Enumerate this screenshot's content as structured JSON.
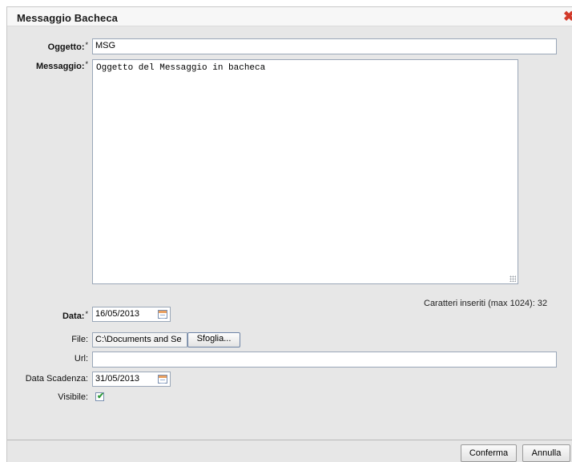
{
  "dialog": {
    "title": "Messaggio Bacheca",
    "close_icon": "close-icon",
    "close_color": "#d23a2a"
  },
  "form": {
    "oggetto": {
      "label": "Oggetto:",
      "required_mark": "*",
      "value": "MSG"
    },
    "messaggio": {
      "label": "Messaggio:",
      "required_mark": "*",
      "value": "Oggetto del Messaggio in bacheca"
    },
    "char_count": "Caratteri inseriti (max 1024): 32",
    "data": {
      "label": "Data:",
      "required_mark": "*",
      "value": "16/05/2013",
      "icon": "calendar-icon"
    },
    "file": {
      "label": "File:",
      "value": "C:\\Documents and Se",
      "browse_label": "Sfoglia..."
    },
    "url": {
      "label": "Url:",
      "value": ""
    },
    "data_scadenza": {
      "label": "Data Scadenza:",
      "value": "31/05/2013",
      "icon": "calendar-icon"
    },
    "visibile": {
      "label": "Visibile:",
      "checked": true,
      "check_glyph": "✔"
    }
  },
  "footer": {
    "confirm_label": "Conferma",
    "cancel_label": "Annulla"
  }
}
